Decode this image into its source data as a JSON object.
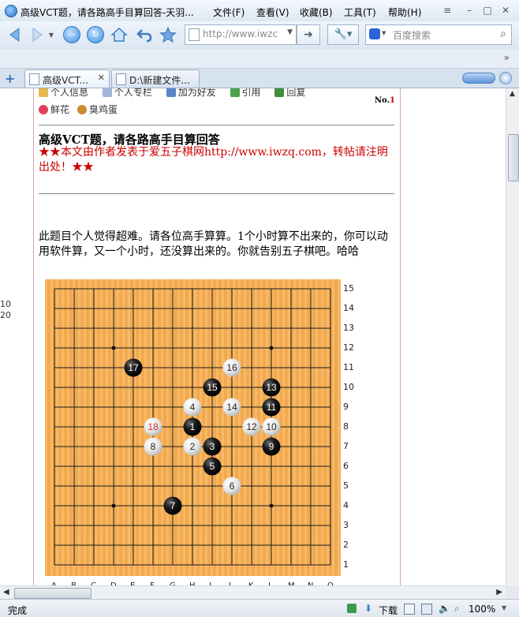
{
  "window": {
    "title": "高级VCT题，请各路高手目算回答-天羽...",
    "menu": [
      "文件(F)",
      "查看(V)",
      "收藏(B)",
      "工具(T)",
      "帮助(H)"
    ]
  },
  "toolbar": {
    "address": "http://www.iwzc",
    "search_placeholder": "百度搜索"
  },
  "tabs": [
    {
      "label": "高级VCT...",
      "active": true
    },
    {
      "label": "D:\\新建文件...",
      "active": false
    }
  ],
  "page": {
    "left_numbers": [
      "10",
      "20"
    ],
    "user_links_row1": [
      "个人信息",
      "个人专栏",
      "加为好友",
      "引用",
      "回复"
    ],
    "user_links_row2": [
      "鲜花",
      "臭鸡蛋"
    ],
    "floor_prefix": "No.",
    "floor_number": "1",
    "title": "高级VCT题，请各路高手目算回答",
    "notice": "★★本文由作者发表于爱五子棋网http://www.iwzq.com，转帖请注明出处！★★",
    "body": "此题目个人觉得超难。请各位高手算算。1个小时算不出来的，你可以动用软件算，又一个小时，还没算出来的。你就告别五子棋吧。哈哈"
  },
  "board": {
    "size": 15,
    "row_labels": [
      "15",
      "14",
      "13",
      "12",
      "11",
      "10",
      "9",
      "8",
      "7",
      "6",
      "5",
      "4",
      "3",
      "2",
      "1"
    ],
    "col_labels": [
      "A",
      "B",
      "C",
      "D",
      "E",
      "F",
      "G",
      "H",
      "I",
      "J",
      "K",
      "L",
      "M",
      "N",
      "O"
    ],
    "stones": [
      {
        "n": "1",
        "color": "black",
        "col": "H",
        "row": 8
      },
      {
        "n": "2",
        "color": "white",
        "col": "H",
        "row": 7
      },
      {
        "n": "3",
        "color": "black",
        "col": "I",
        "row": 7
      },
      {
        "n": "4",
        "color": "white",
        "col": "H",
        "row": 9
      },
      {
        "n": "5",
        "color": "black",
        "col": "I",
        "row": 6
      },
      {
        "n": "6",
        "color": "white",
        "col": "J",
        "row": 5
      },
      {
        "n": "7",
        "color": "black",
        "col": "G",
        "row": 4
      },
      {
        "n": "8",
        "color": "white",
        "col": "F",
        "row": 7
      },
      {
        "n": "9",
        "color": "black",
        "col": "L",
        "row": 7
      },
      {
        "n": "10",
        "color": "white",
        "col": "L",
        "row": 8
      },
      {
        "n": "11",
        "color": "black",
        "col": "L",
        "row": 9
      },
      {
        "n": "12",
        "color": "white",
        "col": "K",
        "row": 8
      },
      {
        "n": "13",
        "color": "black",
        "col": "L",
        "row": 10
      },
      {
        "n": "14",
        "color": "white",
        "col": "J",
        "row": 9
      },
      {
        "n": "15",
        "color": "black",
        "col": "I",
        "row": 10
      },
      {
        "n": "16",
        "color": "white",
        "col": "J",
        "row": 11
      },
      {
        "n": "17",
        "color": "black",
        "col": "E",
        "row": 11
      },
      {
        "n": "18",
        "color": "white",
        "col": "F",
        "row": 8,
        "number_color": "#d03030"
      }
    ],
    "star_points": [
      {
        "col": "D",
        "row": 12
      },
      {
        "col": "L",
        "row": 12
      },
      {
        "col": "D",
        "row": 4
      },
      {
        "col": "L",
        "row": 4
      }
    ]
  },
  "status": {
    "text": "完成",
    "download_label": "下载",
    "zoom": "100%"
  }
}
